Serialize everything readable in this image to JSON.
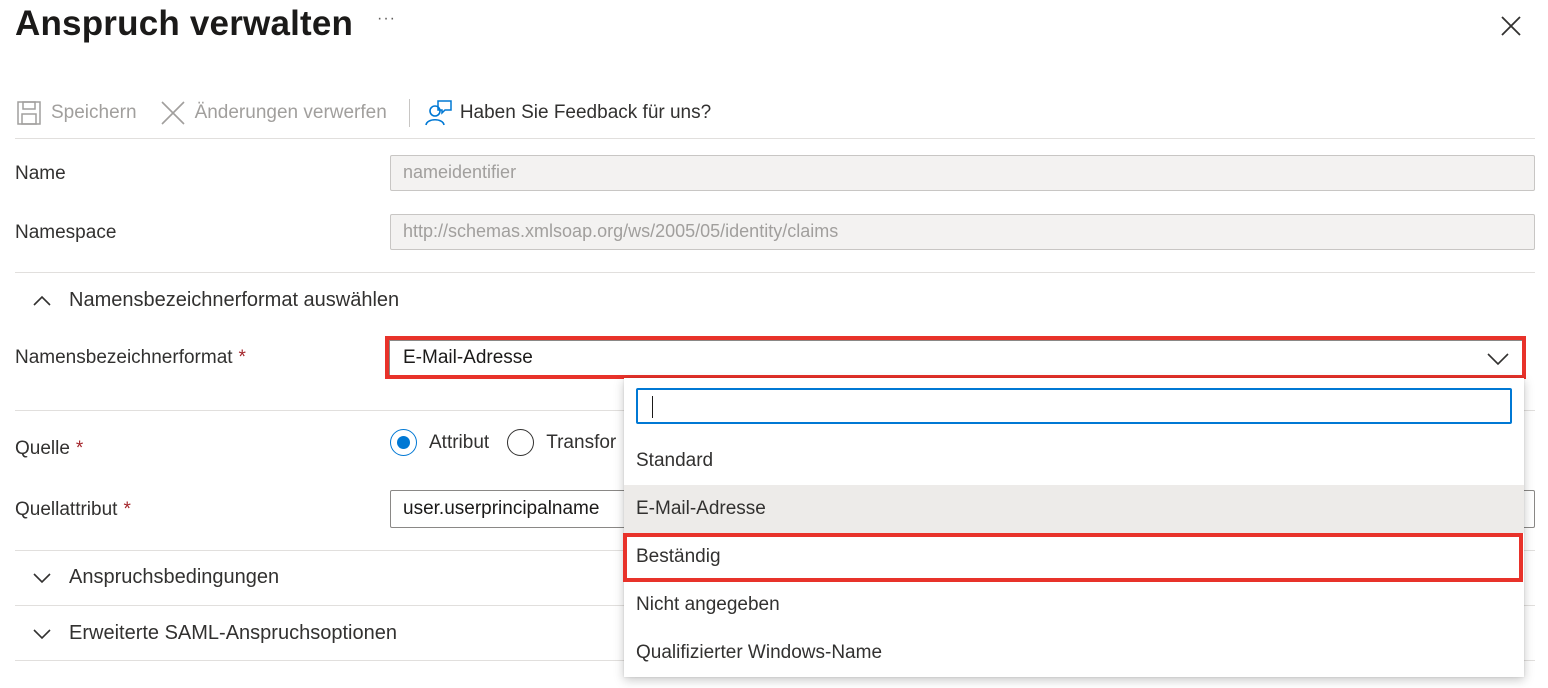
{
  "panel": {
    "title": "Anspruch verwalten",
    "more_label": "···"
  },
  "toolbar": {
    "save_label": "Speichern",
    "discard_label": "Änderungen verwerfen",
    "feedback_label": "Haben Sie Feedback für uns?"
  },
  "fields": {
    "name": {
      "label": "Name",
      "value": "nameidentifier"
    },
    "namespace": {
      "label": "Namespace",
      "value": "http://schemas.xmlsoap.org/ws/2005/05/identity/claims"
    }
  },
  "name_id_section": {
    "title": "Namensbezeichnerformat auswählen",
    "format_label": "Namensbezeichnerformat",
    "required_mark": "*",
    "selected_value": "E-Mail-Adresse"
  },
  "source": {
    "label": "Quelle",
    "required_mark": "*",
    "options": [
      "Attribut",
      "Transfor"
    ],
    "selected": "Attribut"
  },
  "source_attribute": {
    "label": "Quellattribut",
    "required_mark": "*",
    "value": "user.userprincipalname"
  },
  "sections": {
    "conditions": "Anspruchsbedingungen",
    "advanced": "Erweiterte SAML-Anspruchsoptionen"
  },
  "dropdown": {
    "search_value": "",
    "options": [
      "Standard",
      "E-Mail-Adresse",
      "Beständig",
      "Nicht angegeben",
      "Qualifizierter Windows-Name"
    ],
    "selected_option": "E-Mail-Adresse",
    "highlighted_option": "Beständig"
  },
  "colors": {
    "accent": "#0078d4",
    "highlight_box": "#e8322a",
    "required": "#a4262c"
  }
}
